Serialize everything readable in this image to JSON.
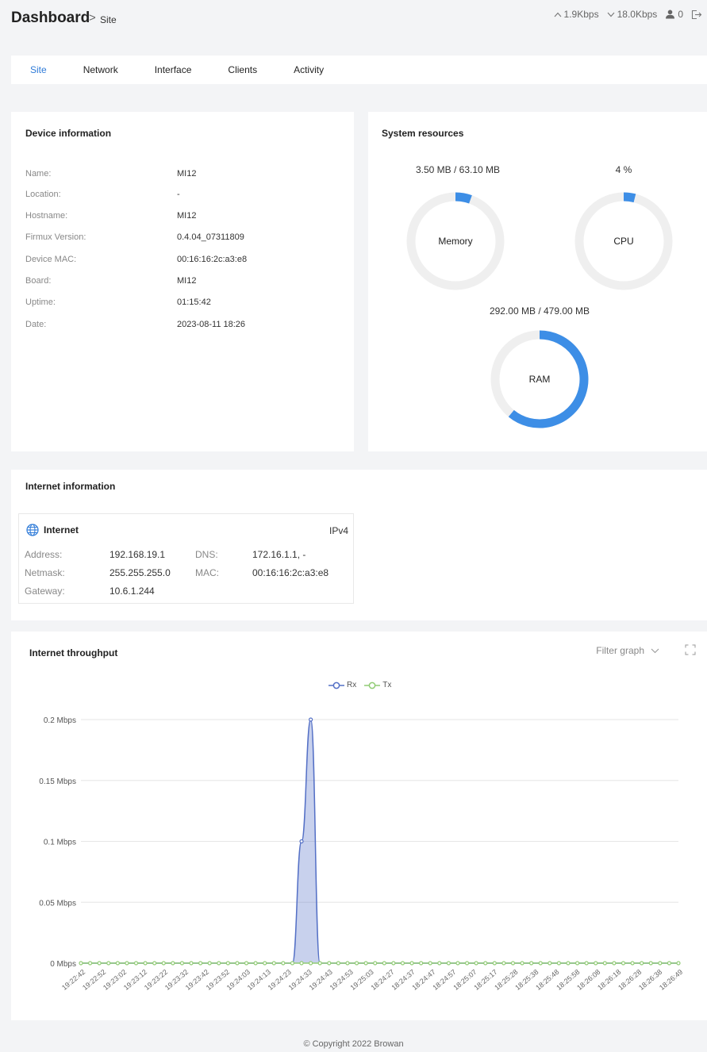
{
  "header": {
    "title": "Dashboard",
    "crumb_sep": ">",
    "crumb": "Site",
    "upload": "1.9Kbps",
    "download": "18.0Kbps",
    "users": "0"
  },
  "tabs": [
    {
      "label": "Site",
      "active": true
    },
    {
      "label": "Network",
      "active": false
    },
    {
      "label": "Interface",
      "active": false
    },
    {
      "label": "Clients",
      "active": false
    },
    {
      "label": "Activity",
      "active": false
    }
  ],
  "device": {
    "title": "Device information",
    "rows": [
      {
        "k": "Name:",
        "v": "MI12"
      },
      {
        "k": "Location:",
        "v": "-"
      },
      {
        "k": "Hostname:",
        "v": "MI12"
      },
      {
        "k": "Firmux Version:",
        "v": "0.4.04_07311809"
      },
      {
        "k": "Device MAC:",
        "v": "00:16:16:2c:a3:e8"
      },
      {
        "k": "Board:",
        "v": "MI12"
      },
      {
        "k": "Uptime:",
        "v": "01:15:42"
      },
      {
        "k": "Date:",
        "v": "2023-08-11 18:26"
      }
    ]
  },
  "system": {
    "title": "System resources",
    "memory": {
      "usage": "3.50 MB / 63.10 MB",
      "label": "Memory",
      "fraction": 0.055
    },
    "cpu": {
      "usage": "4 %",
      "label": "CPU",
      "fraction": 0.04
    },
    "ram": {
      "usage": "292.00 MB / 479.00 MB",
      "label": "RAM",
      "fraction": 0.61
    },
    "colors": {
      "track": "#efefef",
      "fill": "#3d8ee6"
    }
  },
  "internet": {
    "title": "Internet information",
    "name": "Internet",
    "ip_version": "IPv4",
    "address_k": "Address:",
    "address_v": "192.168.19.1",
    "dns_k": "DNS:",
    "dns_v": "172.16.1.1, -",
    "netmask_k": "Netmask:",
    "netmask_v": "255.255.255.0",
    "mac_k": "MAC:",
    "mac_v": "00:16:16:2c:a3:e8",
    "gateway_k": "Gateway:",
    "gateway_v": "10.6.1.244"
  },
  "throughput": {
    "title": "Internet throughput",
    "filter": "Filter graph"
  },
  "chart_data": {
    "type": "area",
    "title": "Internet throughput",
    "ylim": [
      0,
      0.2
    ],
    "y_ticks": [
      "0 Mbps",
      "0.05 Mbps",
      "0.1 Mbps",
      "0.15 Mbps",
      "0.2 Mbps"
    ],
    "y_tick_values": [
      0,
      0.05,
      0.1,
      0.15,
      0.2
    ],
    "x_tick_labels": [
      "19:22:42",
      "19:22:52",
      "19:23:02",
      "19:23:12",
      "19:23:22",
      "19:23:32",
      "19:23:42",
      "19:23:52",
      "19:24:03",
      "19:24:13",
      "19:24:23",
      "19:24:33",
      "19:24:43",
      "19:24:53",
      "19:25:03",
      "18:24:27",
      "18:24:37",
      "18:24:47",
      "18:24:57",
      "18:25:07",
      "18:25:17",
      "18:25:28",
      "18:25:38",
      "18:25:48",
      "18:25:58",
      "18:26:08",
      "18:26:18",
      "18:26:28",
      "18:26:38",
      "18:26:49"
    ],
    "grid": true,
    "legend": "top-center",
    "series": [
      {
        "name": "Rx",
        "color": "#5470c6",
        "values": [
          0,
          0,
          0,
          0,
          0,
          0,
          0,
          0,
          0,
          0,
          0,
          0,
          0,
          0,
          0,
          0,
          0,
          0,
          0,
          0,
          0,
          0,
          0,
          0,
          0,
          0,
          0,
          0,
          0,
          0,
          0,
          0,
          0,
          0,
          0,
          0,
          0,
          0,
          0,
          0,
          0,
          0,
          0,
          0,
          0,
          0,
          0,
          0,
          0,
          0,
          0,
          0,
          0,
          0,
          0,
          0,
          0,
          0,
          0,
          0,
          0,
          0,
          0,
          0,
          0,
          0
        ]
      },
      {
        "name": "Tx",
        "color": "#91cc75",
        "values": [
          0,
          0,
          0,
          0,
          0,
          0,
          0,
          0,
          0,
          0,
          0,
          0,
          0,
          0,
          0,
          0,
          0,
          0,
          0,
          0,
          0,
          0,
          0,
          0,
          0,
          0,
          0,
          0,
          0,
          0,
          0,
          0,
          0,
          0,
          0,
          0,
          0,
          0,
          0,
          0,
          0,
          0,
          0,
          0,
          0,
          0,
          0,
          0,
          0,
          0,
          0,
          0,
          0,
          0,
          0,
          0,
          0,
          0,
          0,
          0,
          0,
          0,
          0,
          0,
          0,
          0
        ]
      }
    ],
    "rx_nonzero": [
      {
        "index": 24,
        "value": 0.1
      },
      {
        "index": 25,
        "value": 0.2
      }
    ]
  },
  "footer": "© Copyright 2022 Browan"
}
